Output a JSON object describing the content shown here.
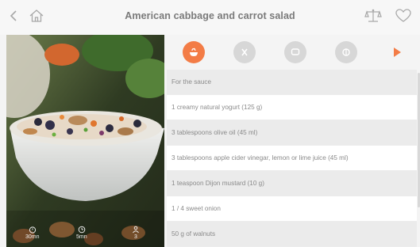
{
  "header": {
    "title": "American cabbage and carrot salad",
    "back_icon": "chevron-left-icon",
    "home_icon": "home-icon",
    "scale_icon": "scale-icon",
    "favorite_icon": "heart-icon"
  },
  "photo": {
    "stats": [
      {
        "icon": "timer-icon",
        "value": "30mn"
      },
      {
        "icon": "clock-icon",
        "value": "5mn"
      },
      {
        "icon": "people-icon",
        "value": "3"
      }
    ]
  },
  "tabs": [
    {
      "icon": "ingredients-icon",
      "active": true
    },
    {
      "icon": "utensils-icon",
      "active": false
    },
    {
      "icon": "comment-icon",
      "active": false
    },
    {
      "icon": "nutrition-icon",
      "active": false
    },
    {
      "icon": "play-icon",
      "active": false
    }
  ],
  "ingredients": [
    "For the sauce",
    "1 creamy natural yogurt (125 g)",
    "3 tablespoons olive oil (45 ml)",
    "3 tablespoons apple cider vinegar, lemon or lime juice (45 ml)",
    "1 teaspoon Dijon mustard (10 g)",
    "1 / 4 sweet onion",
    "50 g of walnuts"
  ],
  "colors": {
    "accent": "#f37c46",
    "inactive_tab": "#d7d7d7",
    "text": "#8a8a8a"
  }
}
